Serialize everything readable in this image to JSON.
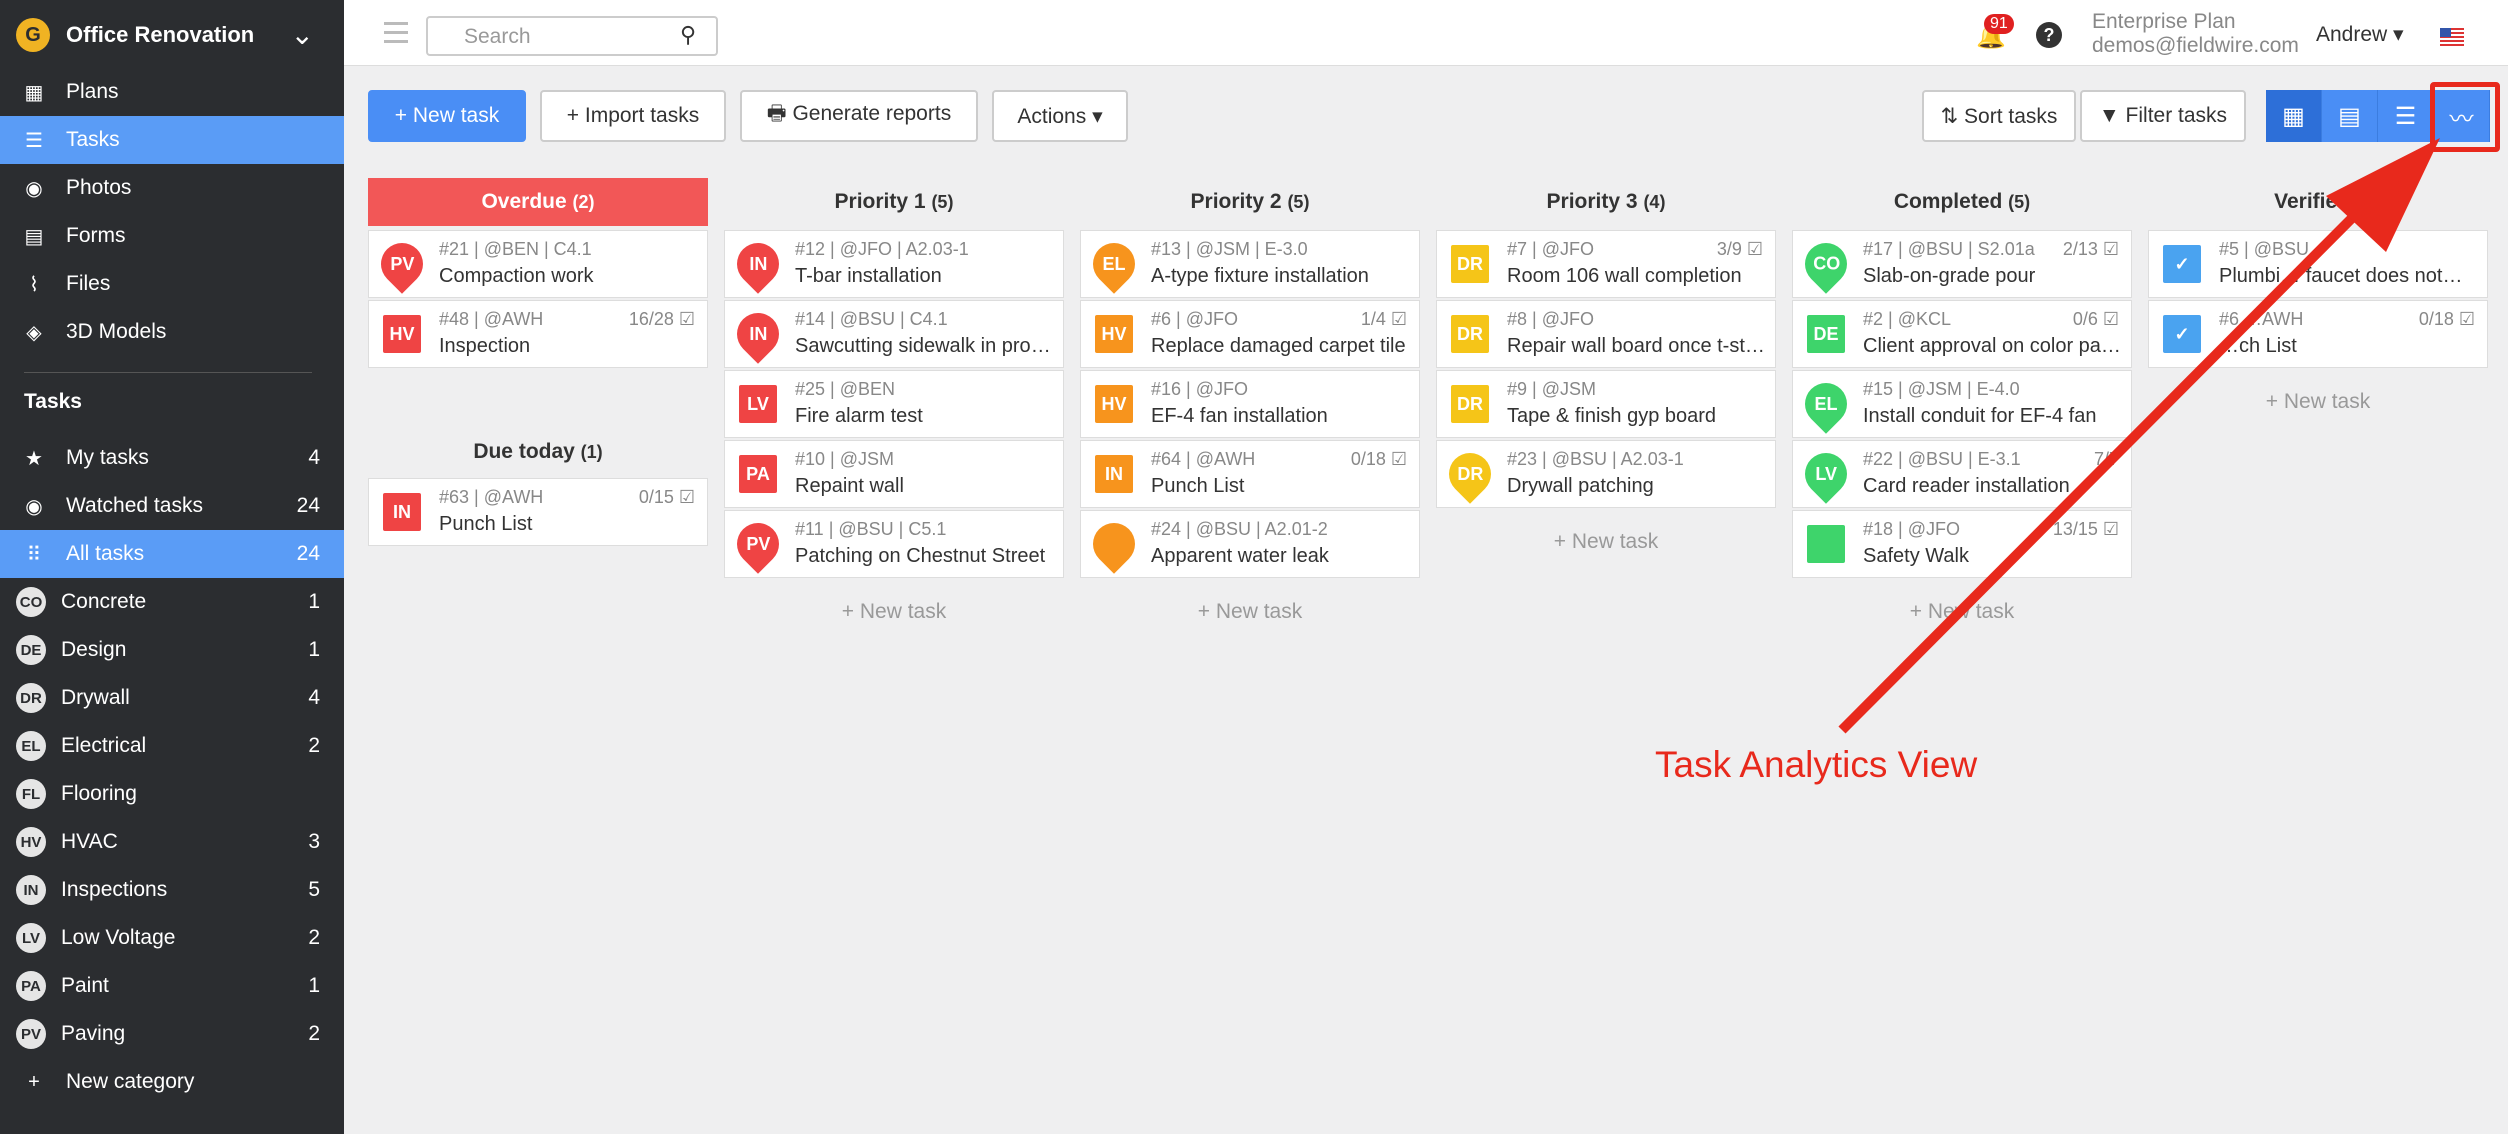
{
  "project": {
    "name": "Office Renovation",
    "logo_letter": "G"
  },
  "sidebar": {
    "nav": [
      {
        "label": "Plans",
        "icon": "plans-icon",
        "glyph": "▦"
      },
      {
        "label": "Tasks",
        "icon": "tasks-list-icon",
        "glyph": "☰",
        "active": true
      },
      {
        "label": "Photos",
        "icon": "camera-icon",
        "glyph": "◉"
      },
      {
        "label": "Forms",
        "icon": "clipboard-icon",
        "glyph": "▤"
      },
      {
        "label": "Files",
        "icon": "paperclip-icon",
        "glyph": "⌇"
      },
      {
        "label": "3D Models",
        "icon": "cube-icon",
        "glyph": "◈"
      }
    ],
    "section_title": "Tasks",
    "task_filters": [
      {
        "label": "My tasks",
        "icon": "star-icon",
        "glyph": "★",
        "count": "4"
      },
      {
        "label": "Watched tasks",
        "icon": "eye-icon",
        "glyph": "◉",
        "count": "24"
      },
      {
        "label": "All tasks",
        "icon": "grid-icon",
        "glyph": "⠿",
        "count": "24",
        "active": true
      }
    ],
    "categories": [
      {
        "badge": "CO",
        "label": "Concrete",
        "count": "1"
      },
      {
        "badge": "DE",
        "label": "Design",
        "count": "1"
      },
      {
        "badge": "DR",
        "label": "Drywall",
        "count": "4"
      },
      {
        "badge": "EL",
        "label": "Electrical",
        "count": "2"
      },
      {
        "badge": "FL",
        "label": "Flooring",
        "count": ""
      },
      {
        "badge": "HV",
        "label": "HVAC",
        "count": "3"
      },
      {
        "badge": "IN",
        "label": "Inspections",
        "count": "5"
      },
      {
        "badge": "LV",
        "label": "Low Voltage",
        "count": "2"
      },
      {
        "badge": "PA",
        "label": "Paint",
        "count": "1"
      },
      {
        "badge": "PV",
        "label": "Paving",
        "count": "2"
      }
    ],
    "new_category": "New category"
  },
  "topbar": {
    "search_placeholder": "Search",
    "notifications": "91",
    "help": "?",
    "plan": "Enterprise Plan",
    "email": "demos@fieldwire.com",
    "user": "Andrew ▾"
  },
  "toolbar": {
    "new_task": "+ New task",
    "import_tasks": "+ Import tasks",
    "generate_reports": "🖶 Generate reports",
    "actions": "Actions ▾",
    "sort_tasks": "⇅ Sort tasks",
    "filter_tasks": "▼ Filter tasks"
  },
  "colors": {
    "red": "#ef4444",
    "orange": "#f7941d",
    "yellow": "#f5c518",
    "green": "#3ed46b",
    "blue": "#4aa3f0"
  },
  "columns": [
    {
      "title": "Overdue",
      "count": "(2)",
      "style": "overdue",
      "cards": [
        {
          "marker": "PV",
          "shape": "pin",
          "color": "red",
          "meta": "#21 | @BEN | C4.1",
          "title": "Compaction work",
          "progress": ""
        },
        {
          "marker": "HV",
          "shape": "sq",
          "color": "red",
          "meta": "#48 | @AWH",
          "title": "Inspection",
          "progress": "16/28 ☑"
        }
      ]
    },
    {
      "title": "Priority 1",
      "count": "(5)",
      "cards": [
        {
          "marker": "IN",
          "shape": "pin",
          "color": "red",
          "meta": "#12 | @JFO | A2.03-1",
          "title": "T-bar installation",
          "progress": ""
        },
        {
          "marker": "IN",
          "shape": "pin",
          "color": "red",
          "meta": "#14 | @BSU | C4.1",
          "title": "Sawcutting sidewalk in progr…",
          "progress": ""
        },
        {
          "marker": "LV",
          "shape": "sq",
          "color": "red",
          "meta": "#25 | @BEN",
          "title": "Fire alarm test",
          "progress": ""
        },
        {
          "marker": "PA",
          "shape": "sq",
          "color": "red",
          "meta": "#10 | @JSM",
          "title": "Repaint wall",
          "progress": ""
        },
        {
          "marker": "PV",
          "shape": "pin",
          "color": "red",
          "meta": "#11 | @BSU | C5.1",
          "title": "Patching on Chestnut Street",
          "progress": ""
        }
      ]
    },
    {
      "title": "Priority 2",
      "count": "(5)",
      "cards": [
        {
          "marker": "EL",
          "shape": "pin",
          "color": "orange",
          "meta": "#13 | @JSM | E-3.0",
          "title": "A-type fixture installation",
          "progress": ""
        },
        {
          "marker": "HV",
          "shape": "sq",
          "color": "orange",
          "meta": "#6 | @JFO",
          "title": "Replace damaged carpet tile",
          "progress": "1/4 ☑"
        },
        {
          "marker": "HV",
          "shape": "sq",
          "color": "orange",
          "meta": "#16 | @JFO",
          "title": "EF-4 fan installation",
          "progress": ""
        },
        {
          "marker": "IN",
          "shape": "sq",
          "color": "orange",
          "meta": "#64 | @AWH",
          "title": "Punch List",
          "progress": "0/18 ☑"
        },
        {
          "marker": "",
          "shape": "pin",
          "color": "orange",
          "meta": "#24 | @BSU | A2.01-2",
          "title": "Apparent water leak",
          "progress": ""
        }
      ]
    },
    {
      "title": "Priority 3",
      "count": "(4)",
      "cards": [
        {
          "marker": "DR",
          "shape": "sq",
          "color": "yellow",
          "meta": "#7 | @JFO",
          "title": "Room 106 wall completion",
          "progress": "3/9 ☑"
        },
        {
          "marker": "DR",
          "shape": "sq",
          "color": "yellow",
          "meta": "#8 | @JFO",
          "title": "Repair wall board once t-stat…",
          "progress": ""
        },
        {
          "marker": "DR",
          "shape": "sq",
          "color": "yellow",
          "meta": "#9 | @JSM",
          "title": "Tape & finish gyp board",
          "progress": ""
        },
        {
          "marker": "DR",
          "shape": "pin",
          "color": "yellow",
          "meta": "#23 | @BSU | A2.03-1",
          "title": "Drywall patching",
          "progress": ""
        }
      ]
    },
    {
      "title": "Completed",
      "count": "(5)",
      "cards": [
        {
          "marker": "CO",
          "shape": "pin",
          "color": "green",
          "meta": "#17 | @BSU | S2.01a",
          "title": "Slab-on-grade pour",
          "progress": "2/13 ☑"
        },
        {
          "marker": "DE",
          "shape": "sq",
          "color": "green",
          "meta": "#2 | @KCL",
          "title": "Client approval on color pale…",
          "progress": "0/6 ☑"
        },
        {
          "marker": "EL",
          "shape": "pin",
          "color": "green",
          "meta": "#15 | @JSM | E-4.0",
          "title": "Install conduit for EF-4 fan",
          "progress": ""
        },
        {
          "marker": "LV",
          "shape": "pin",
          "color": "green",
          "meta": "#22 | @BSU | E-3.1",
          "title": "Card reader installation",
          "progress": "7/7"
        },
        {
          "marker": "",
          "shape": "sq",
          "color": "green",
          "meta": "#18 | @JFO",
          "title": "Safety Walk",
          "progress": "13/15 ☑"
        }
      ]
    },
    {
      "title": "Verified",
      "count": "(",
      "cards": [
        {
          "marker": "✓",
          "shape": "sq",
          "color": "blue",
          "meta": "#5 | @BSU",
          "title": "Plumbi… faucet does not…",
          "progress": ""
        },
        {
          "marker": "✓",
          "shape": "sq",
          "color": "blue",
          "meta": "#6 …AWH",
          "title": "…ch List",
          "progress": "0/18 ☑"
        }
      ]
    }
  ],
  "due_today": {
    "title": "Due today",
    "count": "(1)",
    "cards": [
      {
        "marker": "IN",
        "shape": "sq",
        "color": "red",
        "meta": "#63 | @AWH",
        "title": "Punch List",
        "progress": "0/15 ☑"
      }
    ]
  },
  "new_task_link": "+ New task",
  "annotation": "Task Analytics View"
}
